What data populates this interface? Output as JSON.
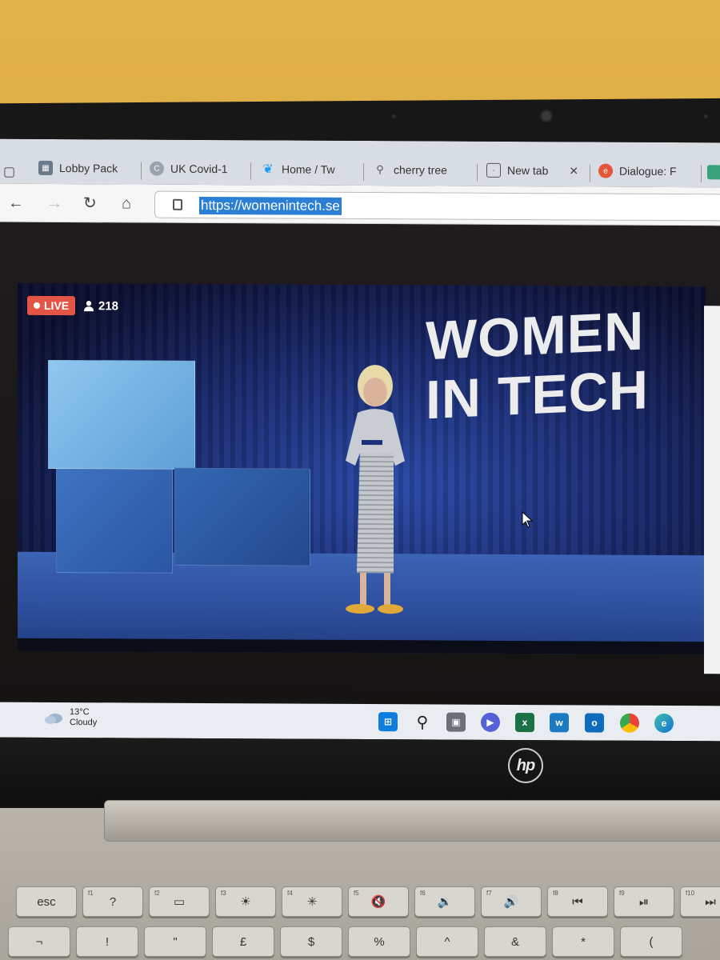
{
  "browser": {
    "tabs": [
      {
        "label": "Lobby Pack",
        "icon": "lobby-pack-favicon",
        "close": ""
      },
      {
        "label": "UK Covid-1",
        "icon": "c-favicon",
        "close": ""
      },
      {
        "label": "Home / Tw",
        "icon": "twitter-bird-icon",
        "close": ""
      },
      {
        "label": "cherry tree",
        "icon": "search-icon",
        "close": ""
      },
      {
        "label": "New tab",
        "icon": "new-tab-icon",
        "close": "✕"
      },
      {
        "label": "Dialogue: F",
        "icon": "dialogue-favicon",
        "close": ""
      }
    ],
    "url": "https://womenintech.se"
  },
  "stream": {
    "live_label": "LIVE",
    "viewer_count": "218",
    "sign_line1": "WOMEN",
    "sign_line2": "IN TECH"
  },
  "taskbar": {
    "temperature": "13°C",
    "condition": "Cloudy"
  },
  "laptop": {
    "brand": "hp"
  },
  "keyboard": {
    "fn_row": [
      {
        "label": "esc",
        "sub": ""
      },
      {
        "label": "?",
        "sub": "f1"
      },
      {
        "label": "▭",
        "sub": "f2"
      },
      {
        "label": "☀",
        "sub": "f3"
      },
      {
        "label": "✳",
        "sub": "f4"
      },
      {
        "label": "🔇",
        "sub": "f5"
      },
      {
        "label": "🔉",
        "sub": "f6"
      },
      {
        "label": "🔊",
        "sub": "f7"
      },
      {
        "label": "⏮",
        "sub": "f8"
      },
      {
        "label": "⏯",
        "sub": "f9"
      },
      {
        "label": "⏭",
        "sub": "f10"
      }
    ],
    "num_row": [
      {
        "label": "¬",
        "sub": ""
      },
      {
        "label": "!",
        "sub": ""
      },
      {
        "label": "\"",
        "sub": ""
      },
      {
        "label": "£",
        "sub": ""
      },
      {
        "label": "$",
        "sub": ""
      },
      {
        "label": "%",
        "sub": ""
      },
      {
        "label": "^",
        "sub": ""
      },
      {
        "label": "&",
        "sub": ""
      },
      {
        "label": "*",
        "sub": ""
      },
      {
        "label": "(",
        "sub": ""
      }
    ]
  }
}
